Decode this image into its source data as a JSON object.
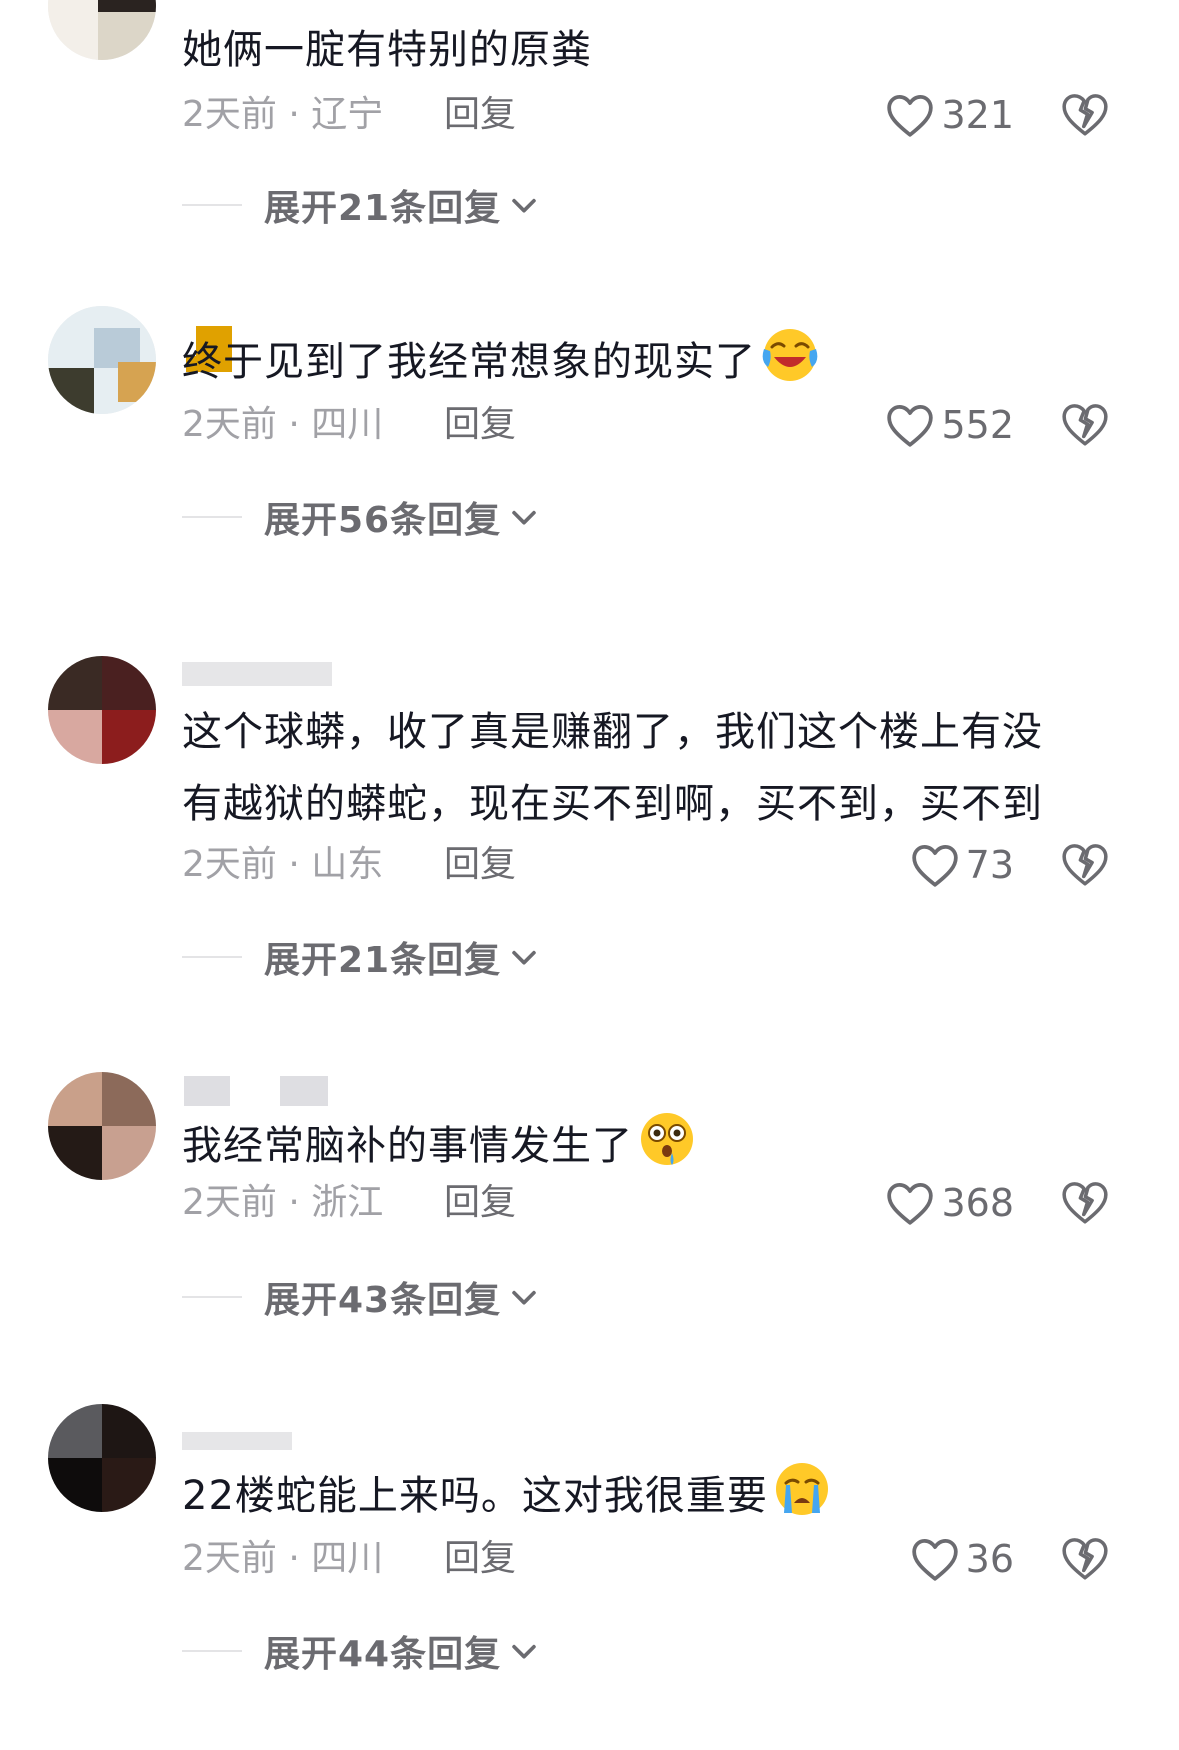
{
  "comments": [
    {
      "text": "她俩一腚有特别的原粪",
      "date_location": "2天前 · 辽宁",
      "reply_label": "回复",
      "likes": "321",
      "expand_label": "展开21条回复"
    },
    {
      "text": "终于见到了我经常想象的现实了",
      "emoji": "laughing-crying-emoji",
      "date_location": "2天前 · 四川",
      "reply_label": "回复",
      "likes": "552",
      "expand_label": "展开56条回复"
    },
    {
      "text_line1": "这个球蟒，收了真是赚翻了，我们这个楼上有没",
      "text_line2": "有越狱的蟒蛇，现在买不到啊，买不到，买不到",
      "date_location": "2天前 · 山东",
      "reply_label": "回复",
      "likes": "73",
      "expand_label": "展开21条回复"
    },
    {
      "text": "我经常脑补的事情发生了",
      "emoji": "flushed-drooling-emoji",
      "date_location": "2天前 · 浙江",
      "reply_label": "回复",
      "likes": "368",
      "expand_label": "展开43条回复"
    },
    {
      "text": "22楼蛇能上来吗。这对我很重要",
      "emoji": "crying-emoji",
      "date_location": "2天前 · 四川",
      "reply_label": "回复",
      "likes": "36",
      "expand_label": "展开44条回复"
    }
  ],
  "colors": {
    "text": "#161823",
    "meta": "#a1a1a6",
    "action": "#6b6b70",
    "divider": "#e4e4e6"
  },
  "icons": {
    "like": "heart-outline-icon",
    "dislike": "broken-heart-icon",
    "expand": "chevron-down-icon"
  }
}
